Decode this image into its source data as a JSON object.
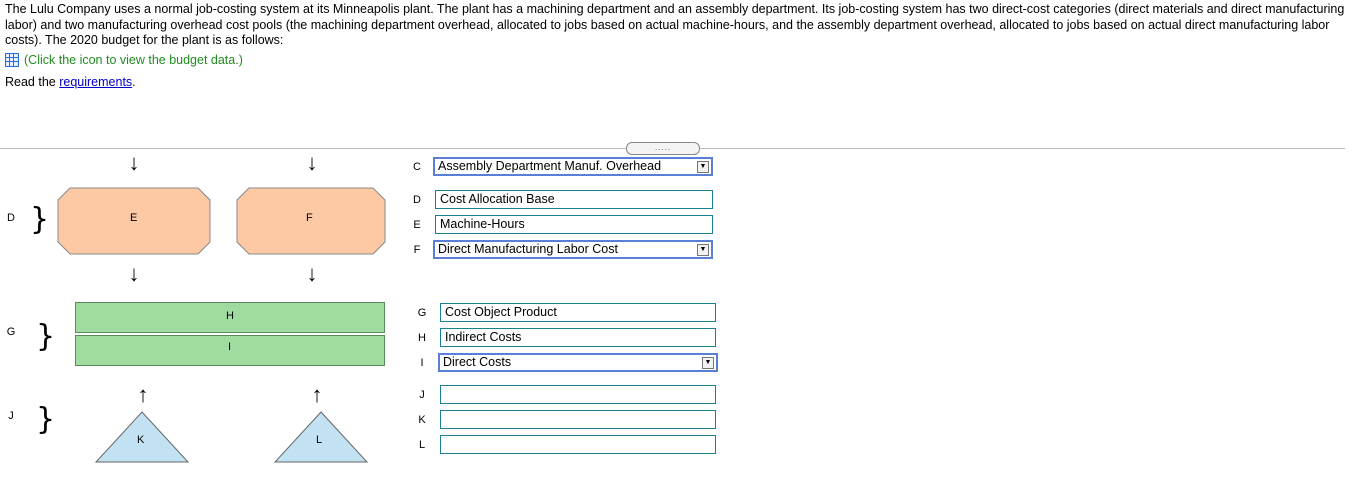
{
  "intro": "The Lulu Company uses a normal job-costing system at its Minneapolis plant. The plant has a machining department and an assembly department. Its job-costing system has two direct-cost categories (direct materials and direct manufacturing labor) and two manufacturing overhead cost pools (the machining department overhead, allocated to jobs based on actual machine-hours, and the assembly department overhead, allocated to jobs based on actual direct manufacturing labor costs). The 2020 budget for the plant is as follows:",
  "budget_link": "(Click the icon to view the budget data.)",
  "read_prefix": "Read the ",
  "read_link": "requirements",
  "read_suffix": ".",
  "pill": ".....",
  "diagram": {
    "left_labels": {
      "d": "D",
      "g": "G",
      "j": "J"
    },
    "pool_left": "E",
    "pool_right": "F",
    "bar_top": "H",
    "bar_bottom": "I",
    "triangle_left": "K",
    "triangle_right": "L",
    "arrow_down": "↓",
    "arrow_up": "↑",
    "brace": "}"
  },
  "answers": [
    {
      "label": "C",
      "value": "Assembly Department Manuf. Overhead",
      "dropdown": true
    },
    {
      "label": "D",
      "value": "Cost Allocation Base",
      "dropdown": false
    },
    {
      "label": "E",
      "value": "Machine-Hours",
      "dropdown": false
    },
    {
      "label": "F",
      "value": "Direct Manufacturing Labor Cost",
      "dropdown": true
    },
    {
      "label": "G",
      "value": "Cost Object Product",
      "dropdown": false
    },
    {
      "label": "H",
      "value": "Indirect Costs",
      "dropdown": false
    },
    {
      "label": "I",
      "value": "Direct Costs",
      "dropdown": true
    },
    {
      "label": "J",
      "value": "",
      "dropdown": false
    },
    {
      "label": "K",
      "value": "",
      "dropdown": false
    },
    {
      "label": "L",
      "value": "",
      "dropdown": false
    }
  ],
  "dropdown_glyph": "▼",
  "colors": {
    "pool": "#fcc9a4",
    "bar": "#a0dca0",
    "triangle": "#c2e2f4",
    "link": "#228b22"
  }
}
